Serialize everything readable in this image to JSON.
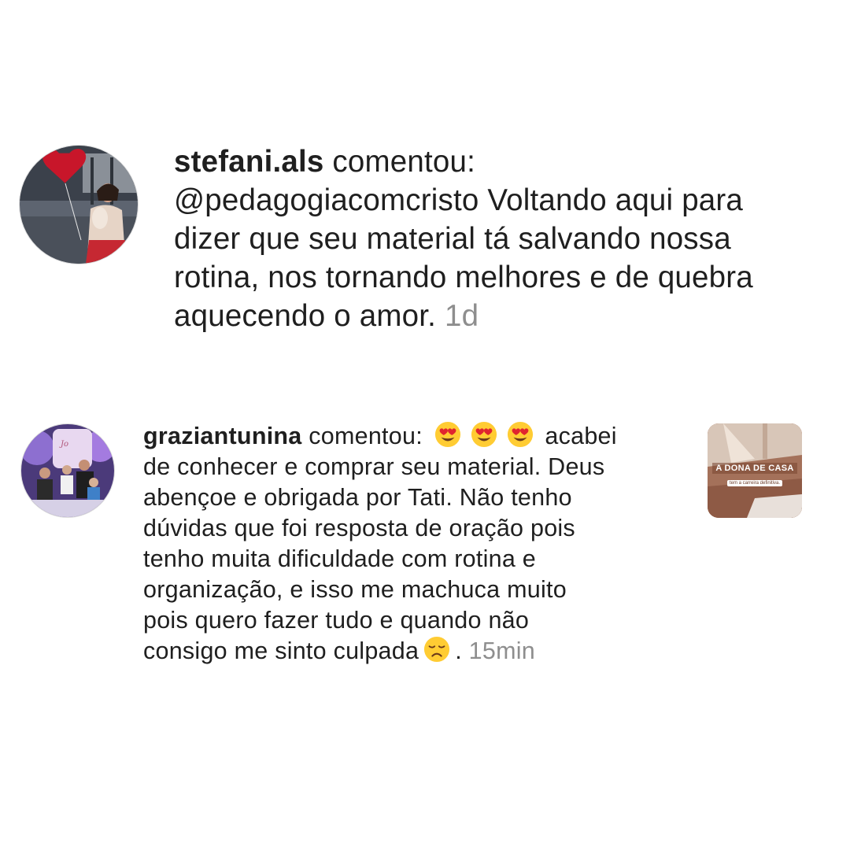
{
  "comments": [
    {
      "username": "stefani.als",
      "action": "comentou:",
      "lines": [
        "@pedagogiacomcristo Voltando aqui para",
        "dizer que seu material tá salvando nossa",
        "rotina, nos tornando melhores e de quebra",
        "aquecendo o amor."
      ],
      "time": "1d",
      "avatar_icon": "profile-photo-woman-red-heart-balloon"
    },
    {
      "username": "graziantunina",
      "action": "comentou:",
      "first_line_after_emojis": "acabei",
      "lines": [
        "de conhecer e comprar seu material. Deus",
        "abençoe e obrigada por Tati. Não tenho",
        "dúvidas que foi resposta de oração pois",
        "tenho muita dificuldade com rotina e",
        "organização,  e isso me machuca muito",
        "pois quero fazer tudo e quando não"
      ],
      "last_line": "consigo me sinto culpada",
      "last_punct": ".",
      "time": "15min",
      "leading_emojis": [
        "heart-eyes-emoji",
        "heart-eyes-emoji",
        "heart-eyes-emoji"
      ],
      "trailing_emoji": "disappointed-face-emoji",
      "avatar_icon": "profile-photo-family-purple-party",
      "thumbnail": {
        "title": "A DONA DE CASA",
        "subtitle": "tem a carreira definitiva."
      }
    }
  ],
  "colors": {
    "text": "#1f1f1f",
    "muted": "#8e8e8e",
    "background": "#ffffff"
  }
}
